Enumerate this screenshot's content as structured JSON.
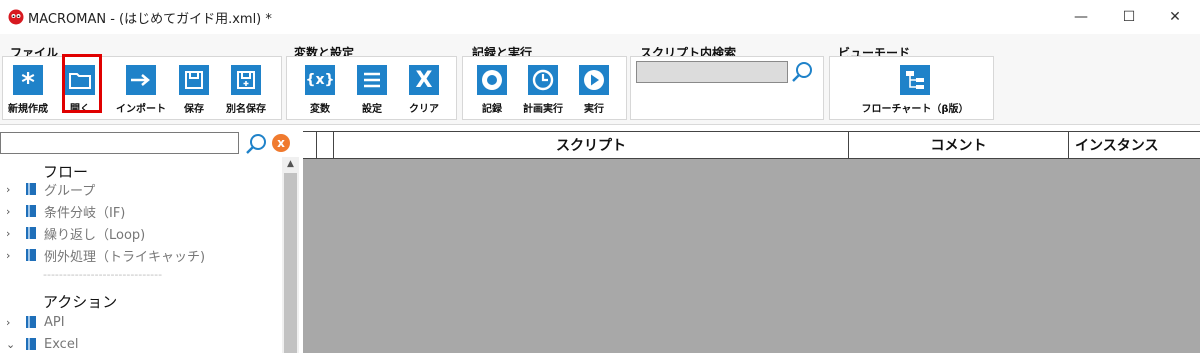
{
  "window": {
    "title": "MACROMAN - (はじめてガイド用.xml) *",
    "controls": [
      "—",
      "☐",
      "✕"
    ]
  },
  "ribbon": {
    "file": {
      "title": "ファイル",
      "buttons": [
        "新規作成",
        "開く",
        "インポート",
        "保存",
        "別名保存"
      ]
    },
    "vars": {
      "title": "変数と設定",
      "buttons": [
        "変数",
        "設定",
        "クリア"
      ]
    },
    "record": {
      "title": "記録と実行",
      "buttons": [
        "記録",
        "計画実行",
        "実行"
      ]
    },
    "search": {
      "title": "スクリプト内検索",
      "value": ""
    },
    "view": {
      "title": "ビューモード",
      "buttons": [
        "フローチャート（β版）"
      ]
    },
    "highlight_color": "#e00000",
    "icon_color": "#1f82c9"
  },
  "tree": {
    "search_value": "",
    "flow_header": "フロー",
    "flow_items": [
      "グループ",
      "条件分岐（IF)",
      "繰り返し（Loop)",
      "例外処理（トライキャッチ)"
    ],
    "separator": "------------------------------",
    "action_header": "アクション",
    "action_items": [
      "API",
      "Excel"
    ]
  },
  "grid": {
    "columns": [
      "スクリプト",
      "コメント",
      "インスタンス"
    ]
  }
}
